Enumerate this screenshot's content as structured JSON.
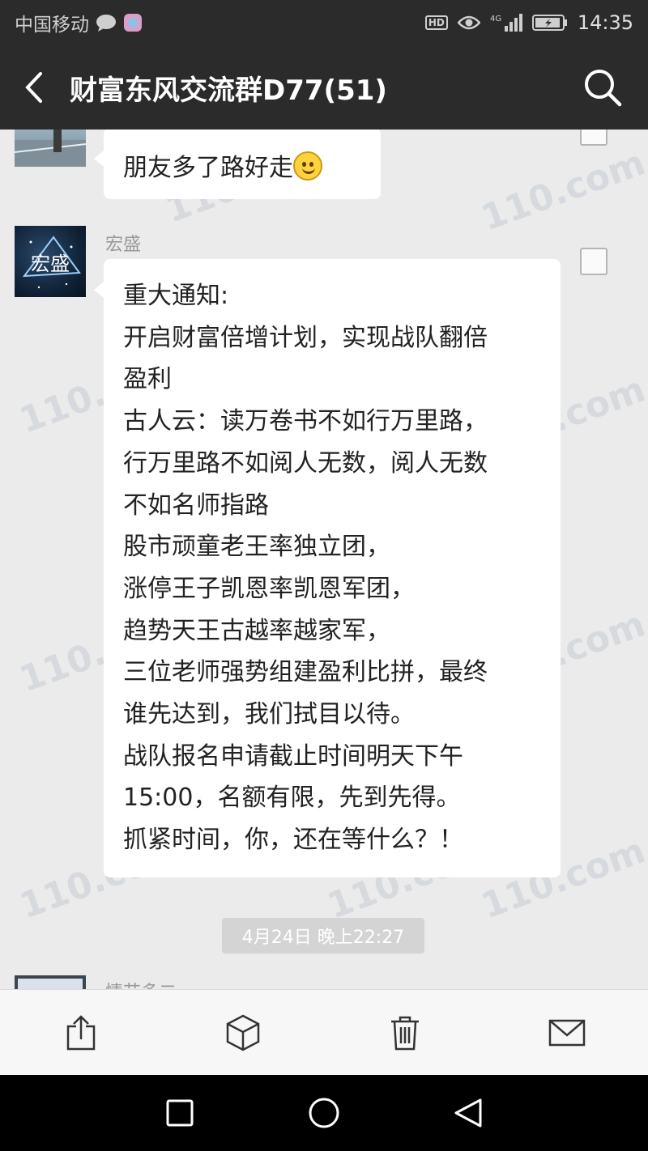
{
  "status_bar": {
    "carrier": "中国移动",
    "network": "4G",
    "hd": "HD",
    "time": "14:35"
  },
  "header": {
    "title": "财富东风交流群D77(51)"
  },
  "messages": [
    {
      "sender": "",
      "text": "朋友多了路好走",
      "emoji": "smiley-icon"
    },
    {
      "sender": "宏盛",
      "avatar_text": "宏盛",
      "lines": [
        "重大通知:",
        "开启财富倍增计划，实现战队翻倍",
        "盈利",
        "古人云：读万卷书不如行万里路，",
        "行万里路不如阅人无数，阅人无数",
        "不如名师指路",
        "股市顽童老王率独立团，",
        "涨停王子凯恩率凯恩军团，",
        "趋势天王古越率越家军，",
        "三位老师强势组建盈利比拼，最终",
        "谁先达到，我们拭目以待。",
        "战队报名申请截止时间明天下午",
        "15:00，名额有限，先到先得。",
        "抓紧时间，你，还在等什么？！"
      ]
    }
  ],
  "timestamp": "4月24日 晚上22:27",
  "next_sender": "情节多二",
  "watermark": "110.com",
  "actions": [
    "share-icon",
    "box-icon",
    "trash-icon",
    "mail-icon"
  ],
  "nav": [
    "recent-apps-button",
    "home-button",
    "back-button"
  ]
}
